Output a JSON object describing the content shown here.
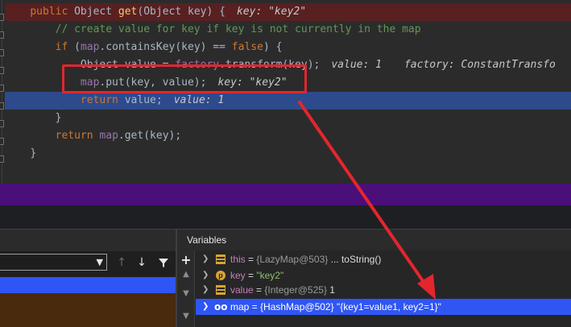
{
  "editor": {
    "lines": {
      "l1": {
        "kw1": "public ",
        "type": "Object ",
        "fn": "get",
        "rest": "(Object key) {",
        "hint": "key: \"key2\""
      },
      "l2": {
        "comment": "// create value for key if key is not currently in the map"
      },
      "l3": {
        "kw1": "if ",
        "p1": "(",
        "field": "map",
        "p2": ".containsKey(key) == ",
        "kw2": "false",
        "p3": ") {"
      },
      "l4": {
        "t1": "Object value = ",
        "field": "factory",
        "t2": ".transform(key);",
        "hint1": "value: 1",
        "hint2": "factory: ConstantTransfo"
      },
      "l5": {
        "field": "map",
        "t1": ".put(key, value);",
        "hint": "key: \"key2\""
      },
      "l6": {
        "kw": "return ",
        "t1": "value;",
        "hint": "value: 1"
      },
      "l7": {
        "t1": "}"
      },
      "l8": {
        "kw": "return ",
        "field": "map",
        "t1": ".get(key);"
      },
      "l9": {
        "t1": "}"
      }
    }
  },
  "variables_panel": {
    "title": "Variables",
    "rows": [
      {
        "name": "this",
        "eq": " = ",
        "type": "{LazyMap@503}",
        "value": " ... toString()",
        "icon": "field-icon"
      },
      {
        "name": "key",
        "eq": " = ",
        "type": "",
        "value": "\"key2\"",
        "icon": "parameter-icon",
        "icon_letter": "p"
      },
      {
        "name": "value",
        "eq": " = ",
        "type": "{Integer@525}",
        "value": " 1",
        "icon": "field-icon"
      },
      {
        "name": "map",
        "eq": " = ",
        "type": "{HashMap@502}",
        "value": " \"{key1=value1, key2=1}\"",
        "icon": "watch-icon",
        "icon_glyph": "oo"
      }
    ]
  },
  "frames_panel": {
    "selected_thread": ""
  },
  "colors": {
    "breakpoint_line": "#582020",
    "current_line": "#2d4a8c",
    "annotation_red": "#e3262e",
    "selection_blue": "#2f55f4"
  }
}
